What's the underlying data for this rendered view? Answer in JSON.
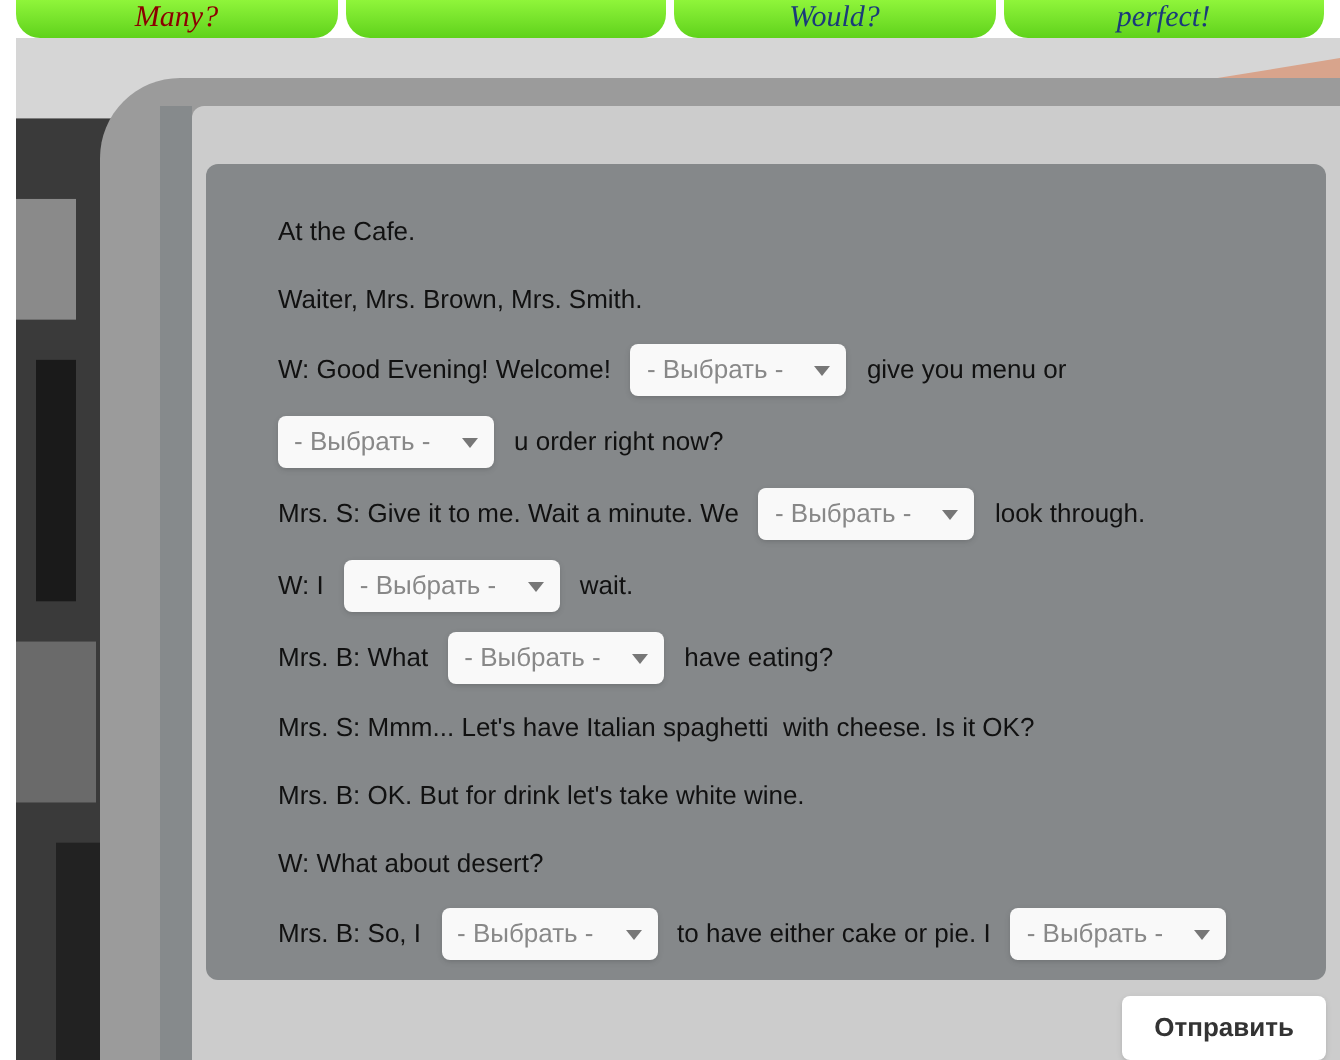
{
  "top_tabs": [
    {
      "kind": "label",
      "label": "Many?",
      "color": "#8b0000"
    },
    {
      "kind": "blank"
    },
    {
      "kind": "label",
      "label": "Would?",
      "color": "#1a3a7a"
    },
    {
      "kind": "label",
      "label": "perfect!",
      "color": "#1a3a7a"
    }
  ],
  "lines": [
    {
      "parts": [
        {
          "kind": "text",
          "text": "At the Cafe."
        }
      ]
    },
    {
      "parts": [
        {
          "kind": "text",
          "text": "Waiter, Mrs. Brown, Mrs. Smith."
        }
      ]
    },
    {
      "parts": [
        {
          "kind": "text",
          "text": "W: Good Evening! Welcome!"
        },
        {
          "kind": "select",
          "placeholder": "- Выбрать -"
        },
        {
          "kind": "text",
          "text": "give you menu or"
        }
      ]
    },
    {
      "parts": [
        {
          "kind": "select",
          "placeholder": "- Выбрать -"
        },
        {
          "kind": "text",
          "text": "u order right now?"
        }
      ]
    },
    {
      "parts": [
        {
          "kind": "text",
          "text": "Mrs. S: Give it to me. Wait a minute. We"
        },
        {
          "kind": "select",
          "placeholder": "- Выбрать -"
        },
        {
          "kind": "text",
          "text": "look through."
        }
      ]
    },
    {
      "parts": [
        {
          "kind": "text",
          "text": "W: I"
        },
        {
          "kind": "select",
          "placeholder": "- Выбрать -"
        },
        {
          "kind": "text",
          "text": "wait."
        }
      ]
    },
    {
      "parts": [
        {
          "kind": "text",
          "text": "Mrs. B: What"
        },
        {
          "kind": "select",
          "placeholder": "- Выбрать -"
        },
        {
          "kind": "text",
          "text": "have eating?"
        }
      ]
    },
    {
      "parts": [
        {
          "kind": "text",
          "text": "Mrs. S: Mmm... Let's have Italian spaghetti  with cheese. Is it OK?"
        }
      ]
    },
    {
      "parts": [
        {
          "kind": "text",
          "text": "Mrs. B: OK. But for drink let's take white wine."
        }
      ]
    },
    {
      "parts": [
        {
          "kind": "text",
          "text": "W: What about desert?"
        }
      ]
    },
    {
      "parts": [
        {
          "kind": "text",
          "text": "Mrs. B: So, I"
        },
        {
          "kind": "select",
          "placeholder": "- Выбрать -"
        },
        {
          "kind": "text",
          "text": "to have either cake or pie. I"
        },
        {
          "kind": "select",
          "placeholder": "- Выбрать -"
        }
      ]
    }
  ],
  "submit_button": "Отправить"
}
